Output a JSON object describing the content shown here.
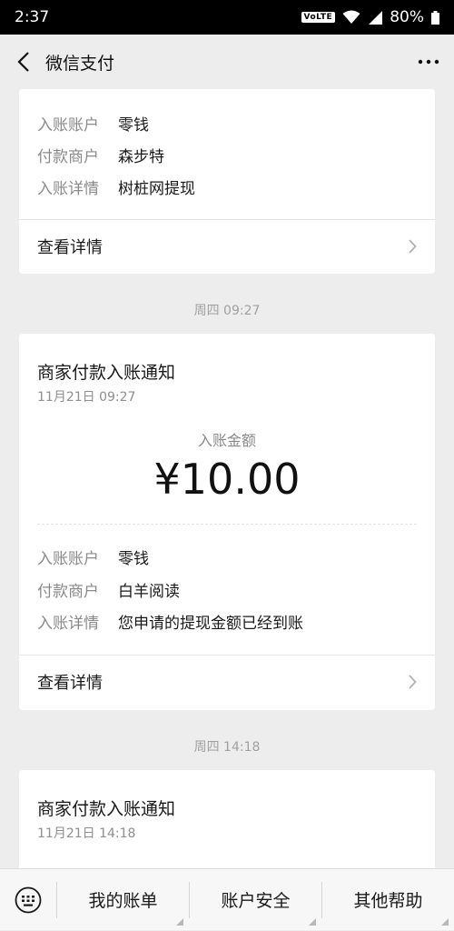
{
  "status": {
    "time": "2:37",
    "volte": "VoLTE",
    "battery": "80%"
  },
  "nav": {
    "title": "微信支付"
  },
  "card1": {
    "rows": [
      {
        "k": "入账账户",
        "v": "零钱"
      },
      {
        "k": "付款商户",
        "v": "森步特"
      },
      {
        "k": "入账详情",
        "v": "树桩网提现"
      }
    ],
    "details": "查看详情"
  },
  "time1": "周四 09:27",
  "card2": {
    "title": "商家付款入账通知",
    "date": "11月21日 09:27",
    "amount_label": "入账金额",
    "amount": "¥10.00",
    "rows": [
      {
        "k": "入账账户",
        "v": "零钱"
      },
      {
        "k": "付款商户",
        "v": "白羊阅读"
      },
      {
        "k": "入账详情",
        "v": "您申请的提现金额已经到账"
      }
    ],
    "details": "查看详情"
  },
  "time2": "周四 14:18",
  "card3": {
    "title": "商家付款入账通知",
    "date": "11月21日 14:18"
  },
  "bottom": {
    "items": [
      "我的账单",
      "账户安全",
      "其他帮助"
    ]
  }
}
